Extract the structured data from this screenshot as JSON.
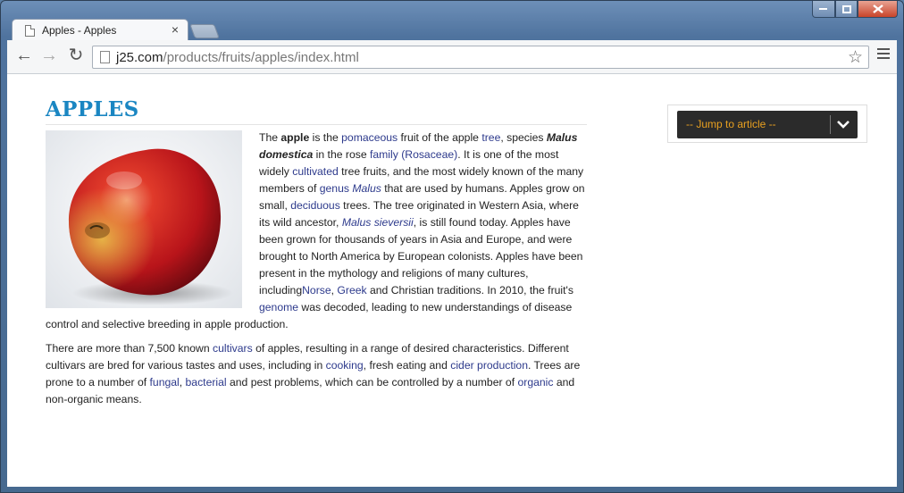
{
  "browser": {
    "tab_title": "Apples - Apples",
    "tab_close": "×",
    "url_host": "j25.com",
    "url_path": "/products/fruits/apples/index.html",
    "bookmark_star": "☆",
    "back": "←",
    "forward": "→",
    "reload": "↻"
  },
  "page": {
    "heading": "APPLES",
    "image_alt": "Red apple",
    "jump_label": "-- Jump to article --",
    "p1": {
      "t1": "The ",
      "b1": "apple",
      "t2": " is the ",
      "l_pomaceous": "pomaceous",
      "t3": " fruit of the apple ",
      "l_tree": "tree",
      "t4": ", species ",
      "bi1": "Malus domestica",
      "t5": " in the rose ",
      "l_family": "family",
      "t6": " ",
      "l_rosaceae": "(Rosaceae)",
      "t7": ". It is one of the most widely ",
      "l_cultivated": "cultivated",
      "t8": " tree fruits, and the most widely known of the many members of ",
      "l_genus": "genus",
      "t9": " ",
      "l_malus": "Malus",
      "t10": " that are used by humans. Apples grow on small, ",
      "l_deciduous": "deciduous",
      "t11": " trees. The tree originated in Western Asia, where its wild ancestor, ",
      "l_sieversii": "Malus sieversii",
      "t12": ", is still found today. Apples have been grown for thousands of years in Asia and Europe, and were brought to North America by European colonists. Apples have been present in the mythology and religions of many cultures, including",
      "l_norse": "Norse",
      "t13": ", ",
      "l_greek": "Greek",
      "t14": " and Christian traditions. In 2010, the fruit's ",
      "l_genome": "genome",
      "t15": " was decoded, leading to new understandings of disease control and selective breeding in apple production."
    },
    "p2": {
      "t1": "There are more than 7,500 known ",
      "l_cultivars": "cultivars",
      "t2": " of apples, resulting in a range of desired characteristics. Different cultivars are bred for various tastes and uses, including in ",
      "l_cooking": "cooking",
      "t3": ", fresh eating and ",
      "l_cider": "cider production",
      "t4": ". Trees are prone to a number of ",
      "l_fungal": "fungal",
      "t5": ", ",
      "l_bacterial": "bacterial",
      "t6": " and pest problems, which can be controlled by a number of ",
      "l_organic": "organic",
      "t7": " and non-organic means."
    }
  },
  "colors": {
    "heading": "#1a86c2",
    "link": "#2d3a8c",
    "jump_bg": "#2b2b2b",
    "jump_text": "#e8a020"
  }
}
